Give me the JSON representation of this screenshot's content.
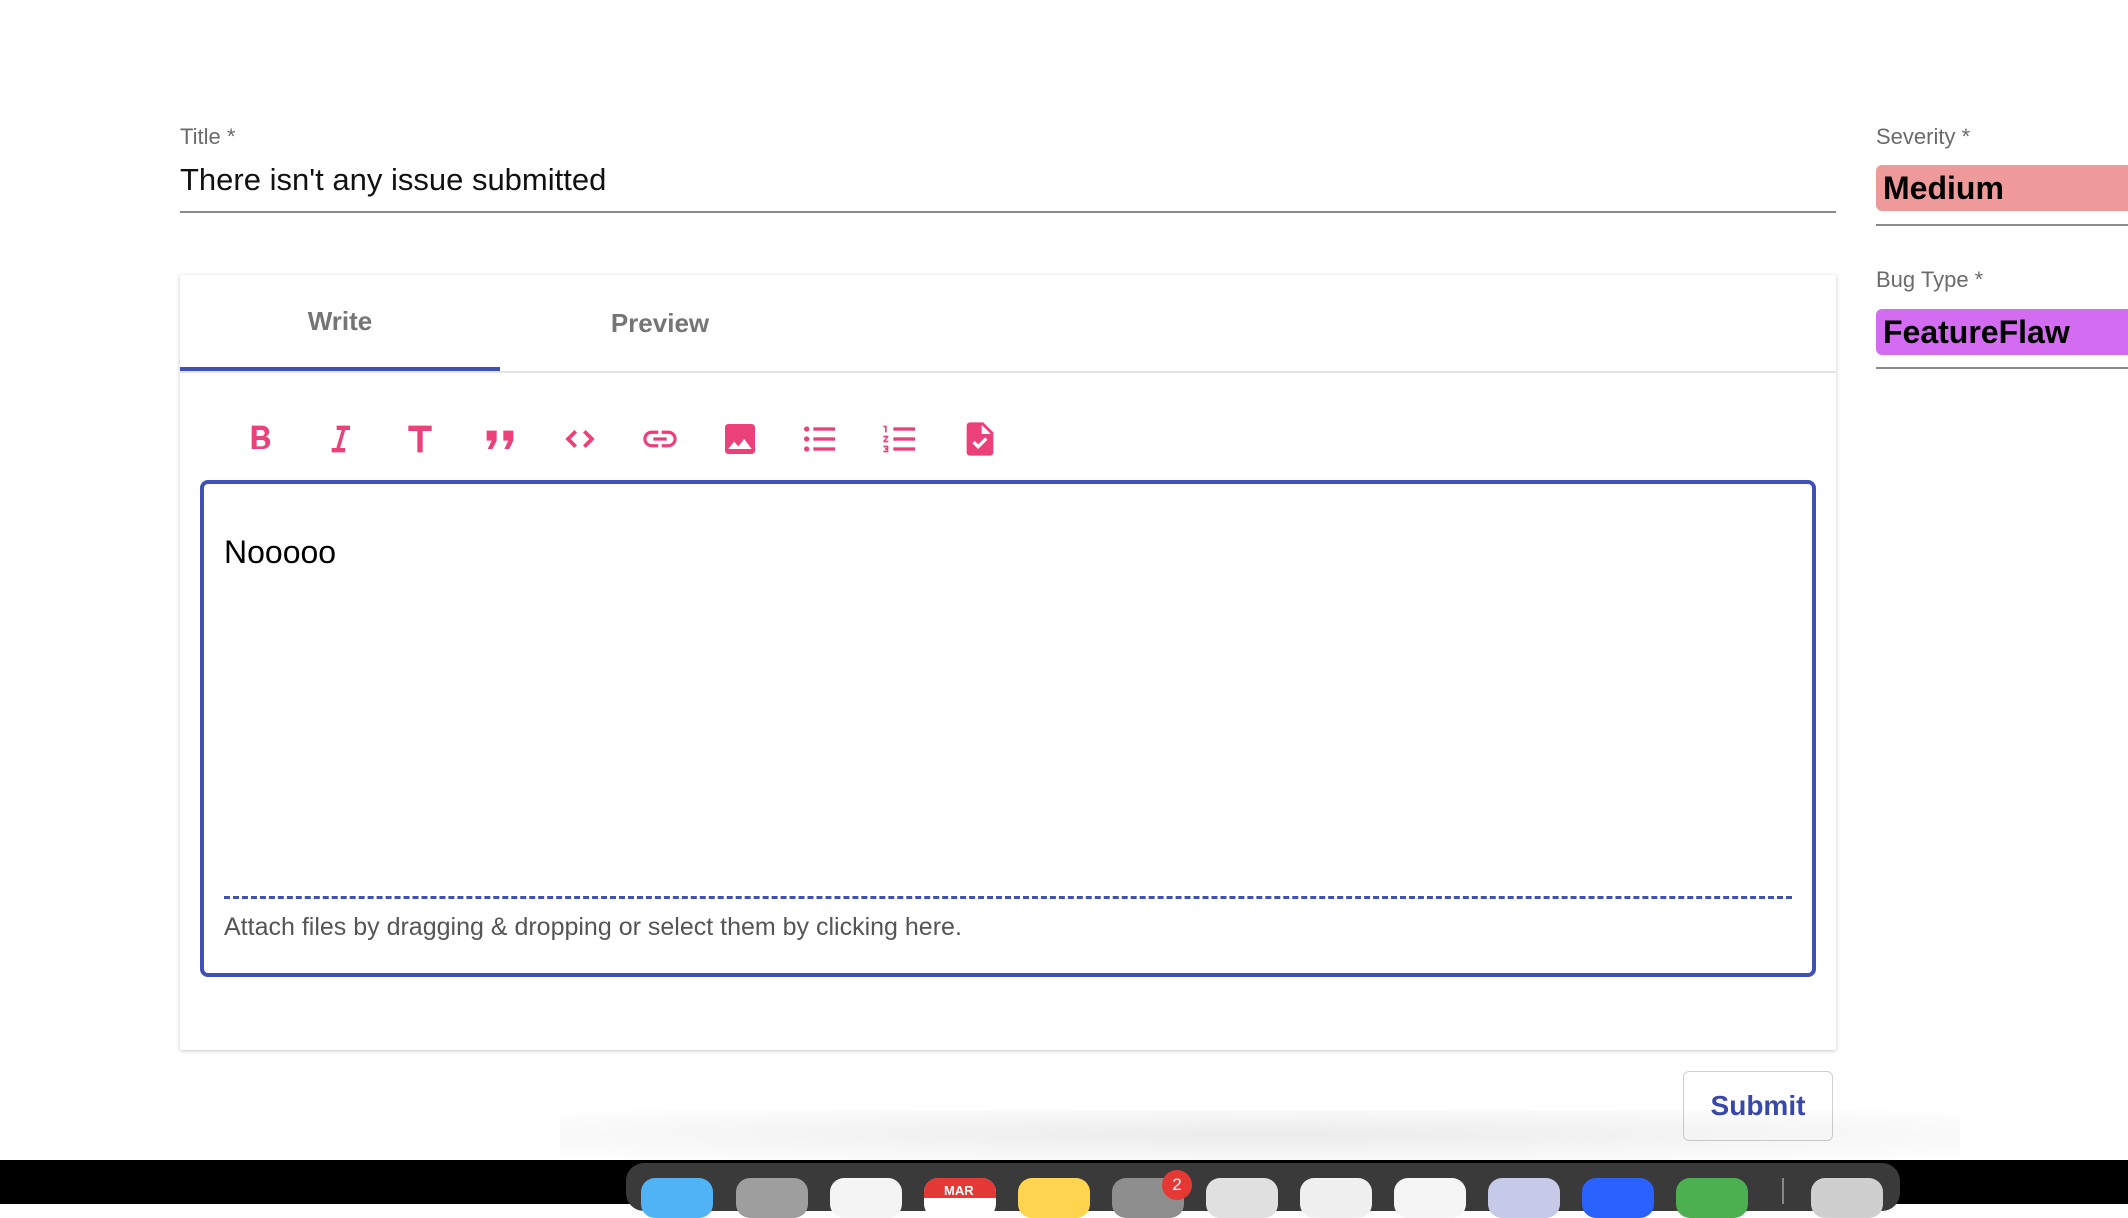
{
  "form": {
    "title_label": "Title *",
    "title_value": "There isn't any issue submitted",
    "severity_label": "Severity *",
    "severity_value": "Medium",
    "bug_type_label": "Bug Type *",
    "bug_type_value": "FeatureFlaw"
  },
  "editor": {
    "tabs": [
      "Write",
      "Preview"
    ],
    "active_tab": "Write",
    "toolbar": [
      "bold-icon",
      "italic-icon",
      "header-icon",
      "quote-icon",
      "code-icon",
      "link-icon",
      "image-icon",
      "unordered-list-icon",
      "ordered-list-icon",
      "checklist-icon"
    ],
    "content": "Nooooo",
    "attach_hint": "Attach files by dragging & dropping or select them by clicking here."
  },
  "actions": {
    "submit_label": "Submit"
  },
  "dock": {
    "calendar_month": "MAR",
    "notification_count": "2"
  },
  "colors": {
    "accent": "#3f51b5",
    "toolbar_icon": "#ec407a",
    "severity_chip": "#ef9a9a",
    "bug_type_chip": "#d36cf0"
  }
}
